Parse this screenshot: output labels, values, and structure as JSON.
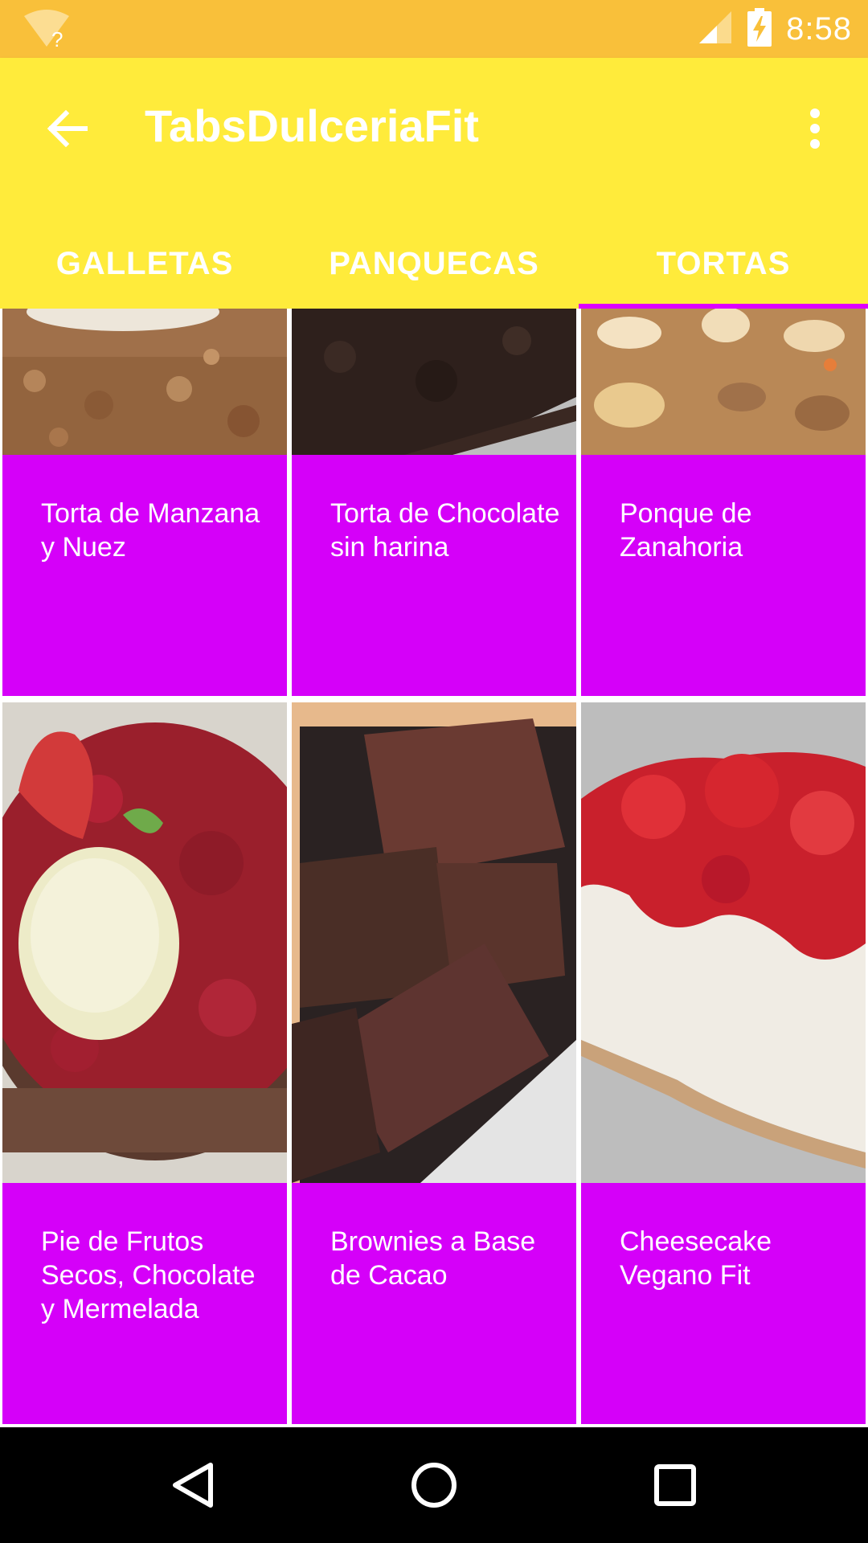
{
  "status_bar": {
    "time": "8:58",
    "wifi_badge": "?",
    "icons": [
      "wifi-unknown-icon",
      "cell-signal-icon",
      "battery-charging-icon"
    ]
  },
  "app_bar": {
    "title": "TabsDulceriaFit",
    "back_icon": "arrow-back-icon",
    "overflow_icon": "more-vert-icon"
  },
  "tabs": [
    {
      "label": "GALLETAS",
      "active": false
    },
    {
      "label": "PANQUECAS",
      "active": false
    },
    {
      "label": "TORTAS",
      "active": true
    }
  ],
  "cards": [
    {
      "label": "Torta de Manzana y Nuez"
    },
    {
      "label": "Torta de Chocolate sin harina"
    },
    {
      "label": "Ponque de Zanahoria"
    },
    {
      "label": "Pie de Frutos Secos, Chocolate y Mermelada"
    },
    {
      "label": "Brownies a Base de Cacao"
    },
    {
      "label": "Cheesecake Vegano Fit"
    }
  ],
  "nav_bar": {
    "icons": [
      "back-triangle-icon",
      "home-circle-icon",
      "recents-square-icon"
    ]
  },
  "colors": {
    "status_bar": "#F9C03A",
    "app_bar": "#FFEB3B",
    "tab_indicator": "#DE00FF",
    "card_caption": "#D500F9",
    "nav_bar": "#000000"
  }
}
